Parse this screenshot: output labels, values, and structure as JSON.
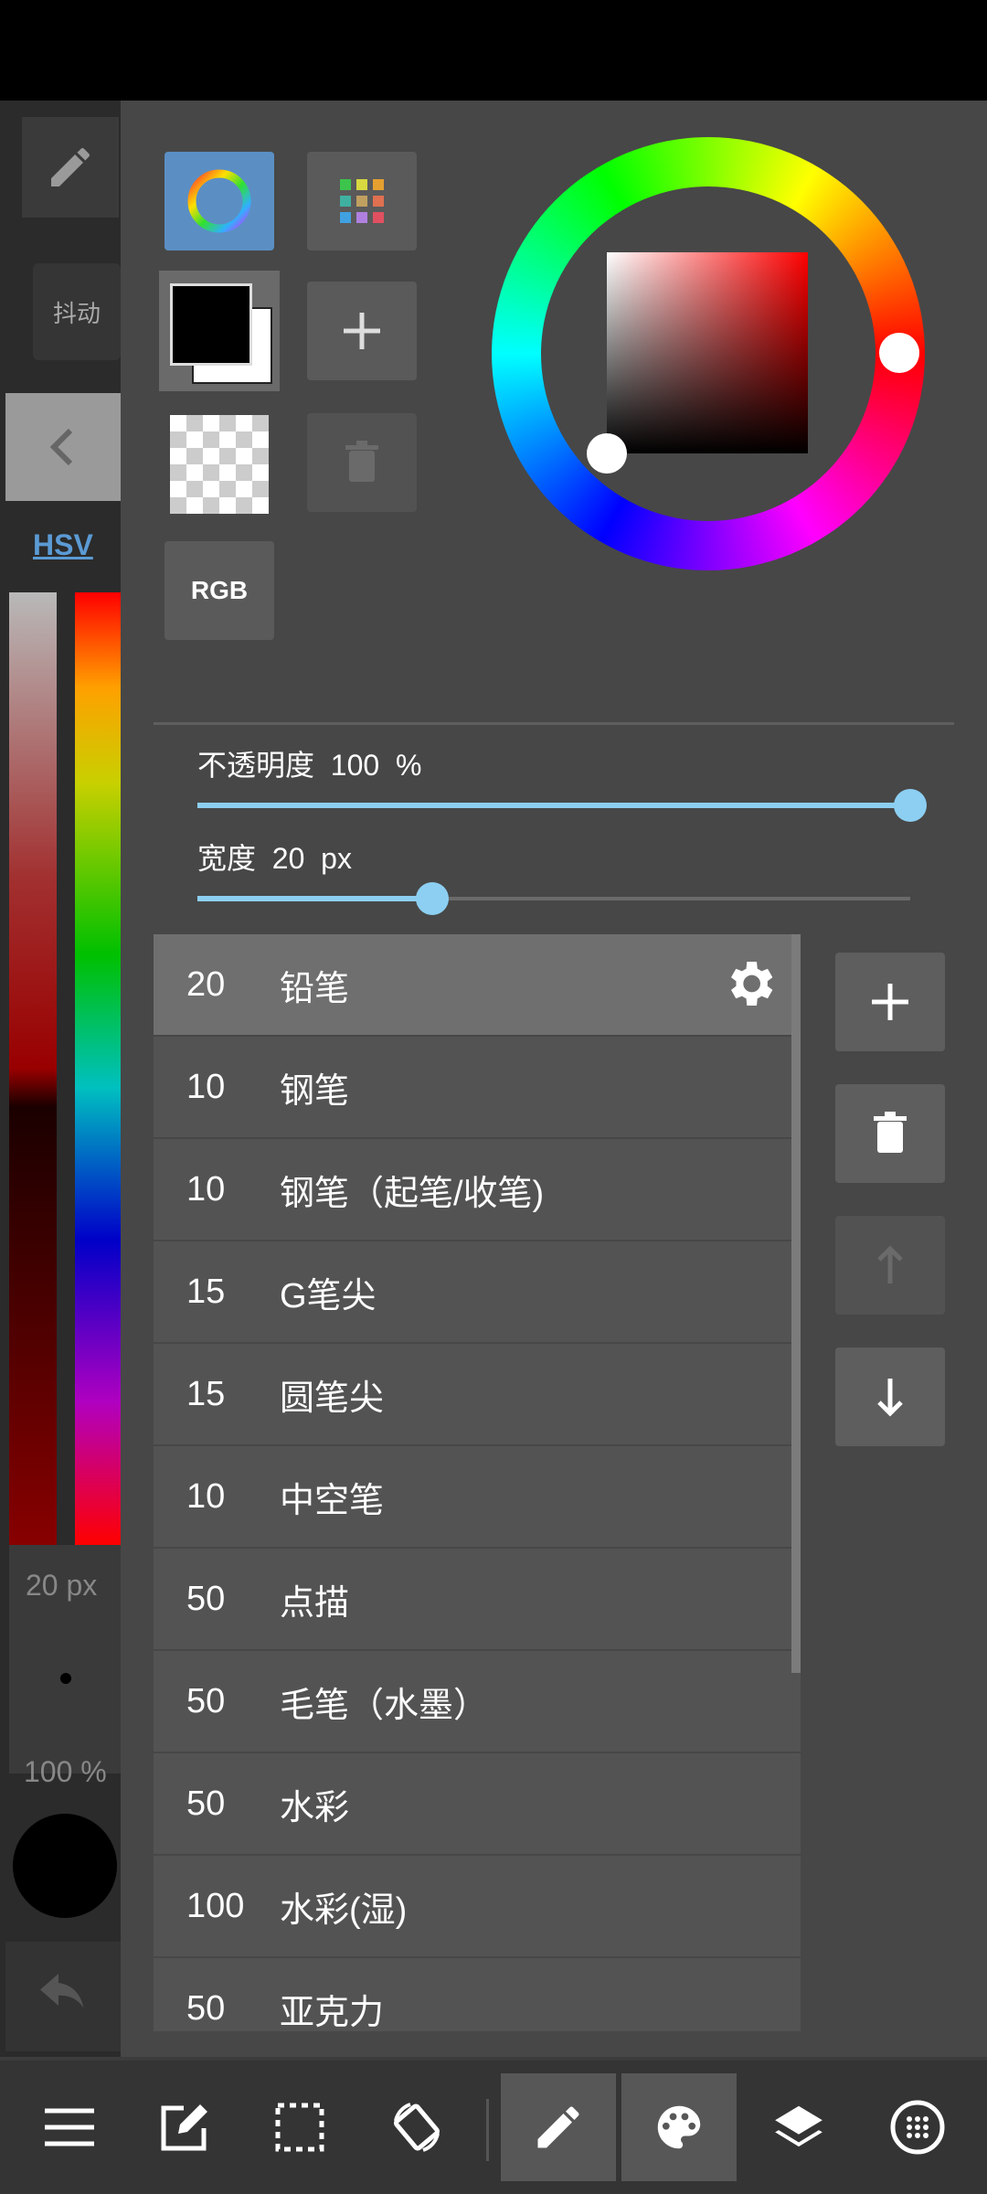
{
  "background_strip": {
    "chip_label": "抖动",
    "mode_link": "HSV",
    "size_readout": "20 px",
    "opacity_readout": "100 %"
  },
  "color_panel": {
    "mode_button_label": "RGB",
    "foreground_color": "#000000",
    "background_color": "#ffffff"
  },
  "opacity": {
    "label": "不透明度",
    "value": "100",
    "unit": "%",
    "level": 1.0
  },
  "width": {
    "label": "宽度",
    "value": "20",
    "unit": "px",
    "level": 0.33
  },
  "brush_list": {
    "items": [
      {
        "size": "20",
        "name": "铅笔",
        "selected": true
      },
      {
        "size": "10",
        "name": "钢笔"
      },
      {
        "size": "10",
        "name": "钢笔（起笔/收笔)"
      },
      {
        "size": "15",
        "name": "G笔尖"
      },
      {
        "size": "15",
        "name": "圆笔尖"
      },
      {
        "size": "10",
        "name": "中空笔"
      },
      {
        "size": "50",
        "name": "点描"
      },
      {
        "size": "50",
        "name": "毛笔（水墨）"
      },
      {
        "size": "50",
        "name": "水彩"
      },
      {
        "size": "100",
        "name": "水彩(湿)"
      },
      {
        "size": "50",
        "name": "亚克力"
      }
    ]
  },
  "bottom_toolbar": {
    "items": [
      "menu-icon",
      "edit-icon",
      "selection-icon",
      "rotate-icon",
      "pencil-icon",
      "palette-icon",
      "layers-icon",
      "grid-icon"
    ],
    "active": [
      "pencil-icon",
      "palette-icon"
    ]
  },
  "colors": {
    "accent": "#8ccff2",
    "panel": "#474747",
    "active_tab": "#5b8fc4"
  }
}
